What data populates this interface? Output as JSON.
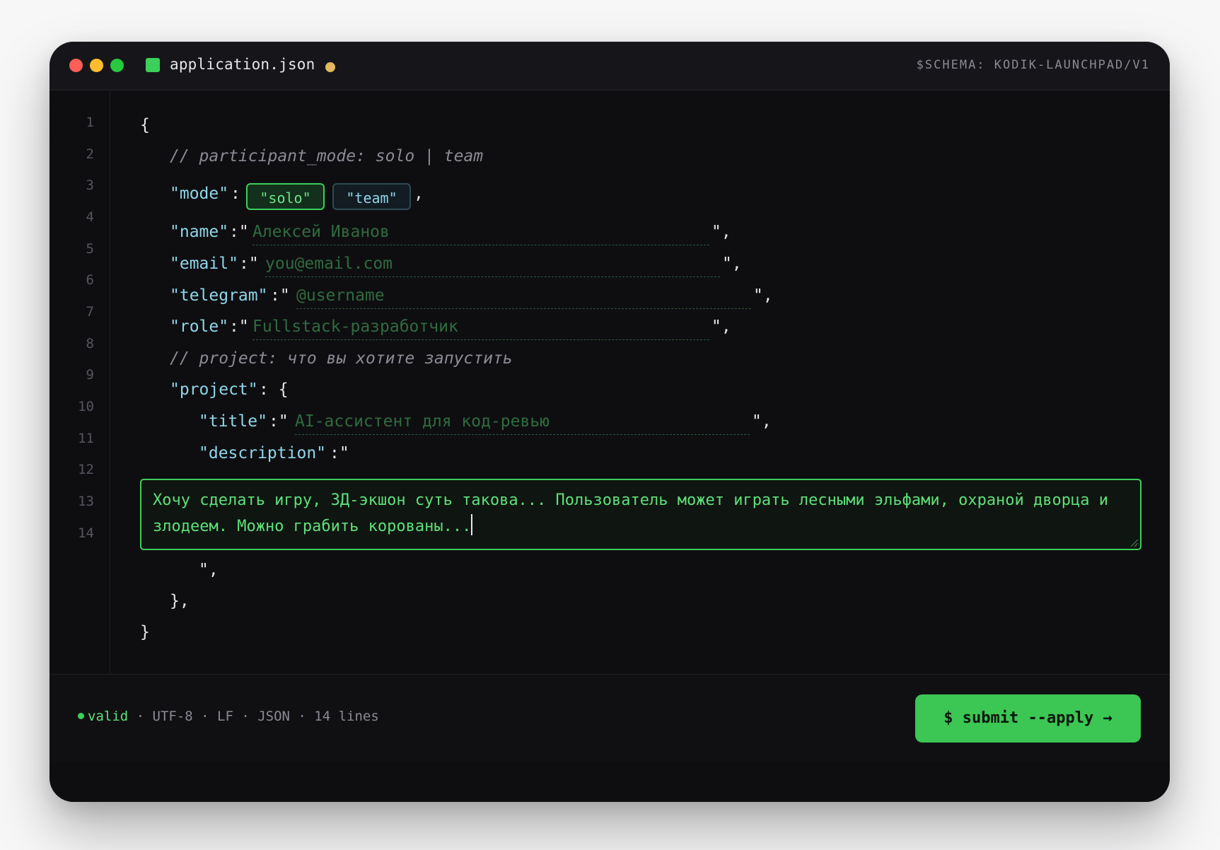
{
  "window": {
    "filename": "application.json",
    "schema": "$SCHEMA: KODIK-LAUNCHPAD/V1",
    "traffic_lights": [
      "#ff5f57",
      "#febc2e",
      "#28c840"
    ],
    "file_icon_color": "#3ccf5a",
    "modified_indicator_color": "#e3b85f"
  },
  "gutter": {
    "line_numbers": [
      "1",
      "2",
      "3",
      "4",
      "5",
      "6",
      "7",
      "8",
      "9",
      "10",
      "11",
      "12",
      "13",
      "14"
    ]
  },
  "code": {
    "open_brace": "{",
    "comment_mode": "// participant_mode: solo | team",
    "mode_key": "\"mode\"",
    "colon": ":",
    "comma": ",",
    "mode_options": [
      "\"solo\"",
      "\"team\""
    ],
    "mode_selected": "\"solo\"",
    "name_key": "\"name\"",
    "name_placeholder": "Алексей Иванов",
    "email_key": "\"email\"",
    "email_placeholder": "you@email.com",
    "telegram_key": "\"telegram\"",
    "telegram_placeholder": "@username",
    "role_key": "\"role\"",
    "role_placeholder": "Fullstack-разработчик",
    "comment_project": "// project: что вы хотите запустить",
    "project_key": "\"project\"",
    "project_open": ": {",
    "title_key": "\"title\"",
    "title_placeholder": "AI-ассистент для код-ревью",
    "description_key": "\"description\"",
    "quote_open": ":\"",
    "quote_close": "\",",
    "description_value": "Хочу сделать игру, 3Д-экшон суть такова... Пользователь может играть лесными эльфами, охраной дворца и злодеем. Можно грабить корованы...",
    "desc_close": "\",",
    "project_close": "},",
    "close_brace": "}"
  },
  "status": {
    "valid": "valid",
    "rest": " · UTF-8 · LF · JSON · 14 lines",
    "accent": "#3ccf5a"
  },
  "submit": {
    "label": "$ submit --apply →"
  }
}
